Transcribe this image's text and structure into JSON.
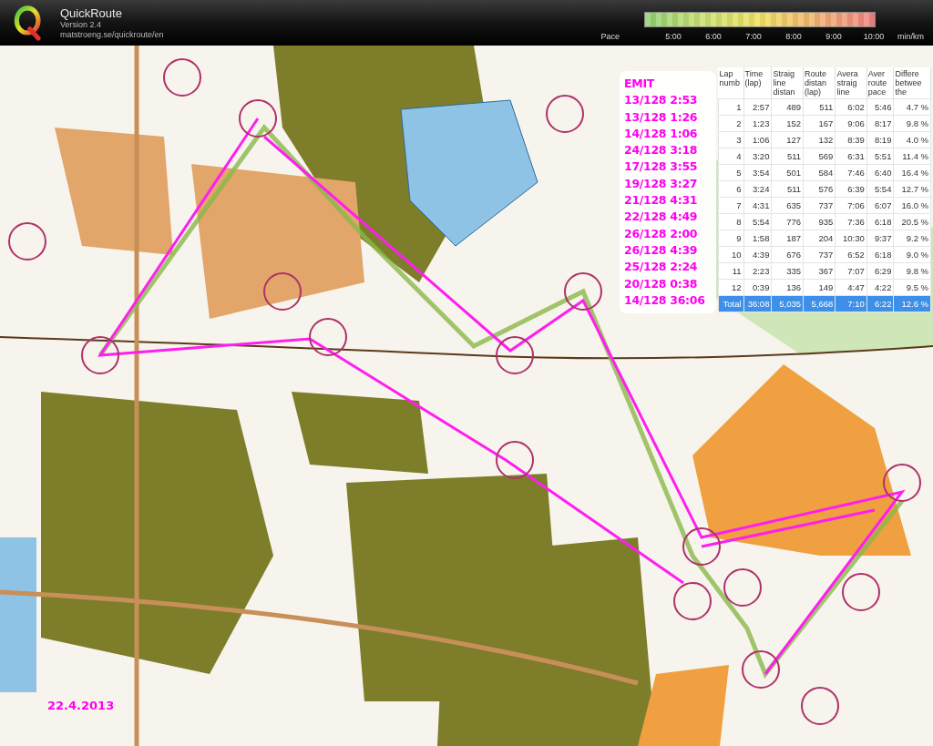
{
  "app": {
    "title": "QuickRoute",
    "version": "Version 2.4",
    "url": "matstroeng.se/quickroute/en"
  },
  "pace_legend": {
    "label": "Pace",
    "ticks": [
      "5:00",
      "6:00",
      "7:00",
      "8:00",
      "9:00",
      "10:00"
    ],
    "unit": "min/km"
  },
  "emit": {
    "title": "EMIT",
    "lines": [
      "13/128 2:53",
      "13/128 1:26",
      "14/128 1:06",
      "24/128 3:18",
      "17/128 3:55",
      "19/128 3:27",
      "21/128 4:31",
      "22/128 4:49",
      "26/128 2:00",
      "26/128 4:39",
      "25/128 2:24",
      "20/128 0:38",
      "14/128 36:06"
    ]
  },
  "laps_table": {
    "columns": [
      "Lap numb",
      "Time (lap)",
      "Straig line distan",
      "Route distan (lap)",
      "Avera straig line",
      "Aver route pace",
      "Differe betwee the"
    ],
    "rows": [
      {
        "kind": "lap",
        "cells": [
          "1",
          "2:57",
          "489",
          "511",
          "6:02",
          "5:46",
          "4.7 %"
        ]
      },
      {
        "kind": "lap",
        "cells": [
          "2",
          "1:23",
          "152",
          "167",
          "9:06",
          "8:17",
          "9.8 %"
        ]
      },
      {
        "kind": "lap",
        "cells": [
          "3",
          "1:06",
          "127",
          "132",
          "8:39",
          "8:19",
          "4.0 %"
        ]
      },
      {
        "kind": "lap",
        "cells": [
          "4",
          "3:20",
          "511",
          "569",
          "6:31",
          "5:51",
          "11.4 %"
        ]
      },
      {
        "kind": "lap",
        "cells": [
          "5",
          "3:54",
          "501",
          "584",
          "7:46",
          "6:40",
          "16.4 %"
        ]
      },
      {
        "kind": "lap",
        "cells": [
          "6",
          "3:24",
          "511",
          "576",
          "6:39",
          "5:54",
          "12.7 %"
        ]
      },
      {
        "kind": "lap",
        "cells": [
          "7",
          "4:31",
          "635",
          "737",
          "7:06",
          "6:07",
          "16.0 %"
        ]
      },
      {
        "kind": "lap",
        "cells": [
          "8",
          "5:54",
          "776",
          "935",
          "7:36",
          "6:18",
          "20.5 %"
        ]
      },
      {
        "kind": "lap",
        "cells": [
          "9",
          "1:58",
          "187",
          "204",
          "10:30",
          "9:37",
          "9.2 %"
        ]
      },
      {
        "kind": "lap",
        "cells": [
          "10",
          "4:39",
          "676",
          "737",
          "6:52",
          "6:18",
          "9.0 %"
        ]
      },
      {
        "kind": "lap",
        "cells": [
          "11",
          "2:23",
          "335",
          "367",
          "7:07",
          "6:29",
          "9.8 %"
        ]
      },
      {
        "kind": "lap",
        "cells": [
          "12",
          "0:39",
          "136",
          "149",
          "4:47",
          "4:22",
          "9.5 %"
        ]
      },
      {
        "kind": "total",
        "cells": [
          "Total",
          "36:08",
          "5,035",
          "5,668",
          "7:10",
          "6:22",
          "12.6 %"
        ]
      }
    ]
  },
  "map": {
    "date": "22.4.2013"
  }
}
